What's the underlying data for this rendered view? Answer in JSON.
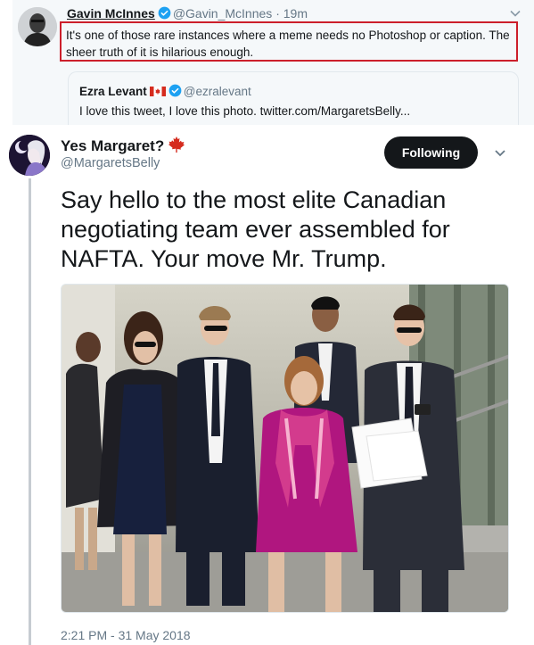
{
  "quoted_tweet": {
    "author_name": "Gavin McInnes",
    "author_handle": "@Gavin_McInnes",
    "time_sep": "·",
    "time": "19m",
    "text": "It's one of those rare instances where a meme needs no Photoshop or caption. The sheer truth of it is hilarious enough.",
    "quote": {
      "author_name": "Ezra Levant",
      "author_handle": "@ezralevant",
      "text": "I love this tweet, I love this photo. twitter.com/MargaretsBelly..."
    }
  },
  "tweet": {
    "author_name": "Yes Margaret?",
    "author_handle": "@MargaretsBelly",
    "follow_label": "Following",
    "text": "Say hello to the most elite Canadian negotiating team ever assembled for NAFTA. Your move Mr. Trump.",
    "timestamp": "2:21 PM - 31 May 2018"
  },
  "colors": {
    "verified_blue": "#1da1f2",
    "highlight_red": "#cc1f2b",
    "maple_red": "#d52b1e",
    "dress_magenta": "#b0167f",
    "text_secondary": "#657786"
  },
  "icons": [
    "verified-badge-icon",
    "chevron-down-icon",
    "canada-flag-icon",
    "maple-leaf-icon"
  ]
}
